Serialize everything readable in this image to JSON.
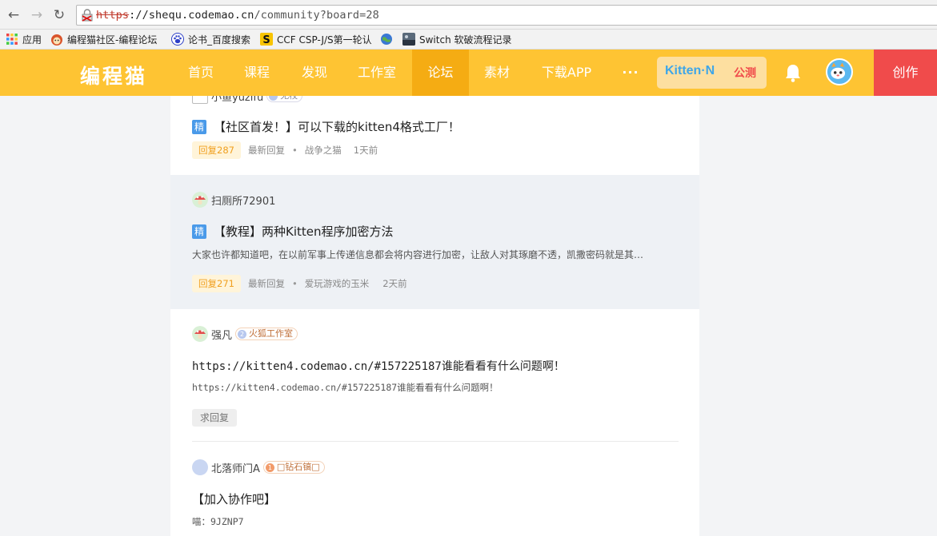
{
  "browser": {
    "url_protocol": "https",
    "url_host": "://shequ.codemao.cn",
    "url_path": "/community?board=28",
    "bookmarks": [
      {
        "label": "应用",
        "icon": "apps-grid-icon"
      },
      {
        "label": "编程猫社区-编程论坛",
        "icon": "codemao-icon"
      },
      {
        "label": "论书_百度搜索",
        "icon": "baidu-paw-icon"
      },
      {
        "label": "CCF CSP-J/S第一轮认",
        "icon": "ccf-icon"
      },
      {
        "label": "",
        "icon": "globe-icon"
      },
      {
        "label": "Switch 软破流程记录",
        "icon": "switch-thumbnail-icon"
      }
    ]
  },
  "header": {
    "logo": "编程猫",
    "nav": [
      {
        "label": "首页",
        "active": false
      },
      {
        "label": "课程",
        "active": false
      },
      {
        "label": "发现",
        "active": false
      },
      {
        "label": "工作室",
        "active": false
      },
      {
        "label": "论坛",
        "active": true
      },
      {
        "label": "素材",
        "active": false
      },
      {
        "label": "下载APP",
        "active": false
      },
      {
        "label": "···",
        "active": false
      }
    ],
    "kitten_brand": "Kitten·N",
    "kitten_badge": "公测",
    "create": "创作",
    "accent": "#fec433",
    "active_nav_bg": "#f5ac13",
    "create_bg": "#f04b4b"
  },
  "posts": [
    {
      "author": "小鱼yuzifu",
      "level": "无校",
      "featured_label": "精",
      "title": "【社区首发！】可以下载的kitten4格式工厂！",
      "reply_count": "回复287",
      "latest_label": "最新回复",
      "latest_user": "战争之猫",
      "time": "1天前"
    },
    {
      "author": "扫厕所72901",
      "featured_label": "精",
      "title": "【教程】两种Kitten程序加密方法",
      "excerpt": "大家也许都知道吧，在以前军事上传递信息都会将内容进行加密，让敌人对其琢磨不透，凯撒密码就是其…",
      "reply_count": "回复271",
      "latest_label": "最新回复",
      "latest_user": "爱玩游戏的玉米",
      "time": "2天前"
    },
    {
      "author": "强凡",
      "level_num": "2",
      "level": "火狐工作室",
      "title": "https://kitten4.codemao.cn/#157225187谁能看看有什么问题啊！",
      "excerpt": "https://kitten4.codemao.cn/#157225187谁能看看有什么问题啊！",
      "ask_reply": "求回复"
    },
    {
      "author": "北落师门A",
      "level_num": "1",
      "level": "□钻石镐□",
      "title": "【加入协作吧】",
      "excerpt": "喵：9JZNP7"
    }
  ]
}
